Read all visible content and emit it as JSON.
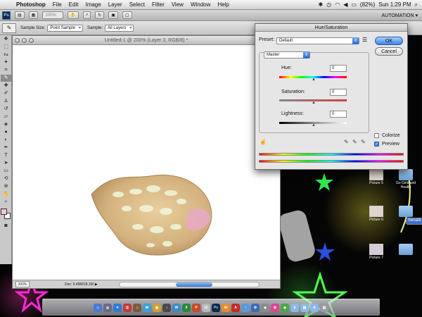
{
  "menubar": {
    "apple": "",
    "app_name": "Photoshop",
    "items": [
      "File",
      "Edit",
      "Image",
      "Layer",
      "Select",
      "Filter",
      "View",
      "Window",
      "Help"
    ],
    "battery": "(82%)",
    "clock": "Sun 1:29 PM"
  },
  "appbar": {
    "logo": "Ps",
    "zoom": "100%",
    "workspace": "AUTOMATION ▾"
  },
  "options": {
    "sample_size_label": "Sample Size:",
    "sample_size_value": "Point Sample",
    "sample_label": "Sample:",
    "sample_value": "All Layers"
  },
  "document": {
    "title": "Untitled-1 @ 200% (Layer 3, RGB/8) *",
    "zoom": "200%",
    "doc_info": "Doc: 5.49M/18.1M"
  },
  "hue_saturation": {
    "title": "Hue/Saturation",
    "preset_label": "Preset:",
    "preset_value": "Default",
    "ok_label": "OK",
    "cancel_label": "Cancel",
    "channel_value": "Master",
    "hue_label": "Hue:",
    "hue_value": "0",
    "saturation_label": "Saturation:",
    "saturation_value": "0",
    "lightness_label": "Lightness:",
    "lightness_value": "0",
    "colorize_label": "Colorize",
    "colorize_checked": false,
    "preview_label": "Preview",
    "preview_checked": true
  },
  "desktop": {
    "icons": [
      {
        "name": "Picture 5",
        "selected": false
      },
      {
        "name": "Go Girls and Health",
        "selected": false
      },
      {
        "name": "Picture 6",
        "selected": false
      },
      {
        "name": "Senate",
        "selected": true
      },
      {
        "name": "Picture 7",
        "selected": false
      }
    ]
  },
  "colors": {
    "accent": "#3b82e0",
    "foreground_swatch": "#f2c6d6"
  }
}
